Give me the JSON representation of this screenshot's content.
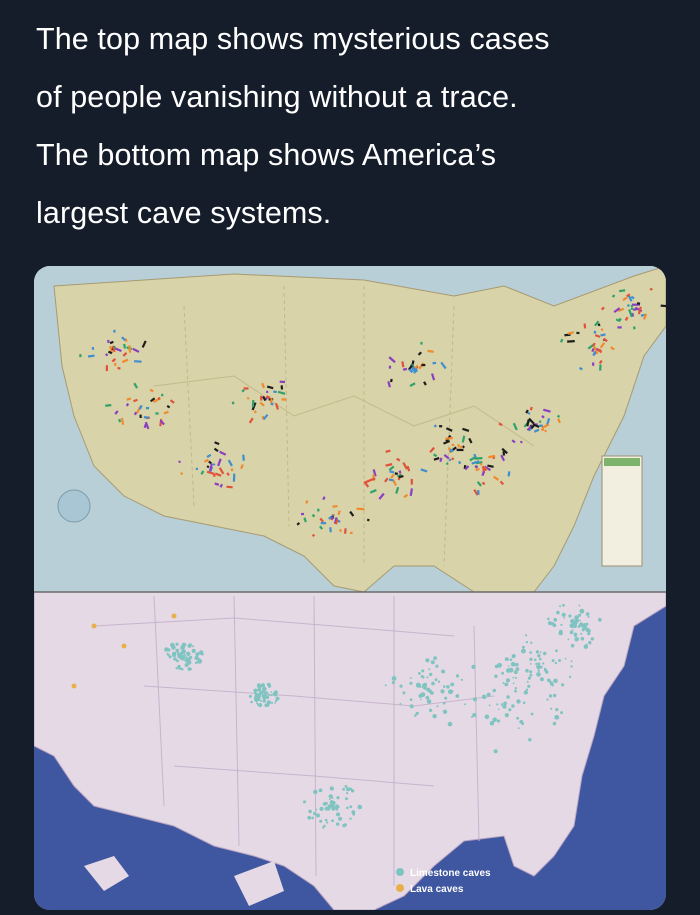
{
  "caption": {
    "line1": "The top map shows mysterious cases",
    "line2": "of people vanishing without a trace.",
    "line3": "The bottom map shows America’s",
    "line4": "largest cave systems."
  },
  "bottom_map": {
    "legend": [
      {
        "label": "Limestone caves",
        "color": "#7fc4c0"
      },
      {
        "label": "Lava caves",
        "color": "#e8b04a"
      }
    ]
  },
  "colors": {
    "background": "#151d2a",
    "ocean_top": "#b8cfd8",
    "ocean_bottom": "#3f56a0",
    "land_top": "#d8d3a8",
    "land_bottom": "#e6d9e6"
  }
}
